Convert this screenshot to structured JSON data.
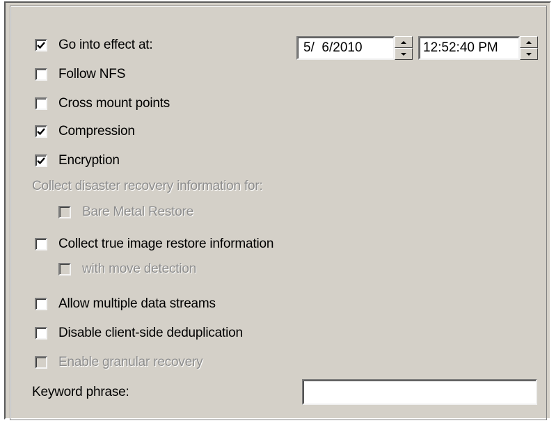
{
  "options": {
    "go_into_effect": {
      "label": "Go into effect at:",
      "checked": true
    },
    "follow_nfs": {
      "label": "Follow NFS",
      "checked": false
    },
    "cross_mount_points": {
      "label": "Cross mount points",
      "checked": false
    },
    "compression": {
      "label": "Compression",
      "checked": true
    },
    "encryption": {
      "label": "Encryption",
      "checked": true
    },
    "disaster_recovery_heading": "Collect disaster recovery information for:",
    "bare_metal_restore": {
      "label": "Bare Metal Restore",
      "checked": false,
      "enabled": false
    },
    "true_image_restore": {
      "label": "Collect true image restore information",
      "checked": false
    },
    "with_move_detection": {
      "label": "with move detection",
      "checked": false,
      "enabled": false
    },
    "multiple_data_streams": {
      "label": "Allow multiple data streams",
      "checked": false
    },
    "disable_dedup": {
      "label": "Disable client-side deduplication",
      "checked": false
    },
    "granular_recovery": {
      "label": "Enable granular recovery",
      "checked": false,
      "enabled": false
    },
    "keyword_phrase": {
      "label": "Keyword phrase:",
      "value": ""
    }
  },
  "schedule": {
    "date": "5/  6/2010",
    "time": "12:52:40 PM"
  }
}
